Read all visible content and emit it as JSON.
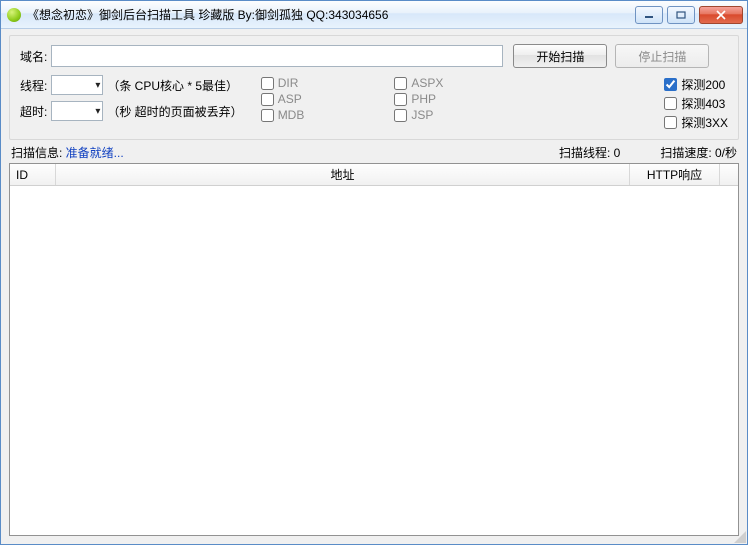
{
  "title": "《想念初恋》御剑后台扫描工具 珍藏版 By:御剑孤独 QQ:343034656",
  "labels": {
    "domain": "域名:",
    "threads": "线程:",
    "timeout": "超时:"
  },
  "hints": {
    "threads": "（条 CPU核心 * 5最佳）",
    "timeout": "（秒 超时的页面被丢弃）"
  },
  "inputs": {
    "domain": "",
    "threads": "",
    "timeout": ""
  },
  "buttons": {
    "start": "开始扫描",
    "stop": "停止扫描"
  },
  "filetypes": [
    {
      "key": "dir",
      "label": "DIR",
      "checked": false
    },
    {
      "key": "asp",
      "label": "ASP",
      "checked": false
    },
    {
      "key": "mdb",
      "label": "MDB",
      "checked": false
    },
    {
      "key": "aspx",
      "label": "ASPX",
      "checked": false
    },
    {
      "key": "php",
      "label": "PHP",
      "checked": false
    },
    {
      "key": "jsp",
      "label": "JSP",
      "checked": false
    }
  ],
  "probes": [
    {
      "key": "p200",
      "label": "探测200",
      "checked": true
    },
    {
      "key": "p403",
      "label": "探测403",
      "checked": false
    },
    {
      "key": "p3xx",
      "label": "探测3XX",
      "checked": false
    }
  ],
  "status": {
    "prefix": "扫描信息: ",
    "ready": "准备就绪...",
    "threads_label": "扫描线程: ",
    "threads_value": "0",
    "speed_label": "扫描速度: ",
    "speed_value": "0/秒"
  },
  "columns": {
    "id": "ID",
    "addr": "地址",
    "resp": "HTTP响应"
  },
  "rows": []
}
